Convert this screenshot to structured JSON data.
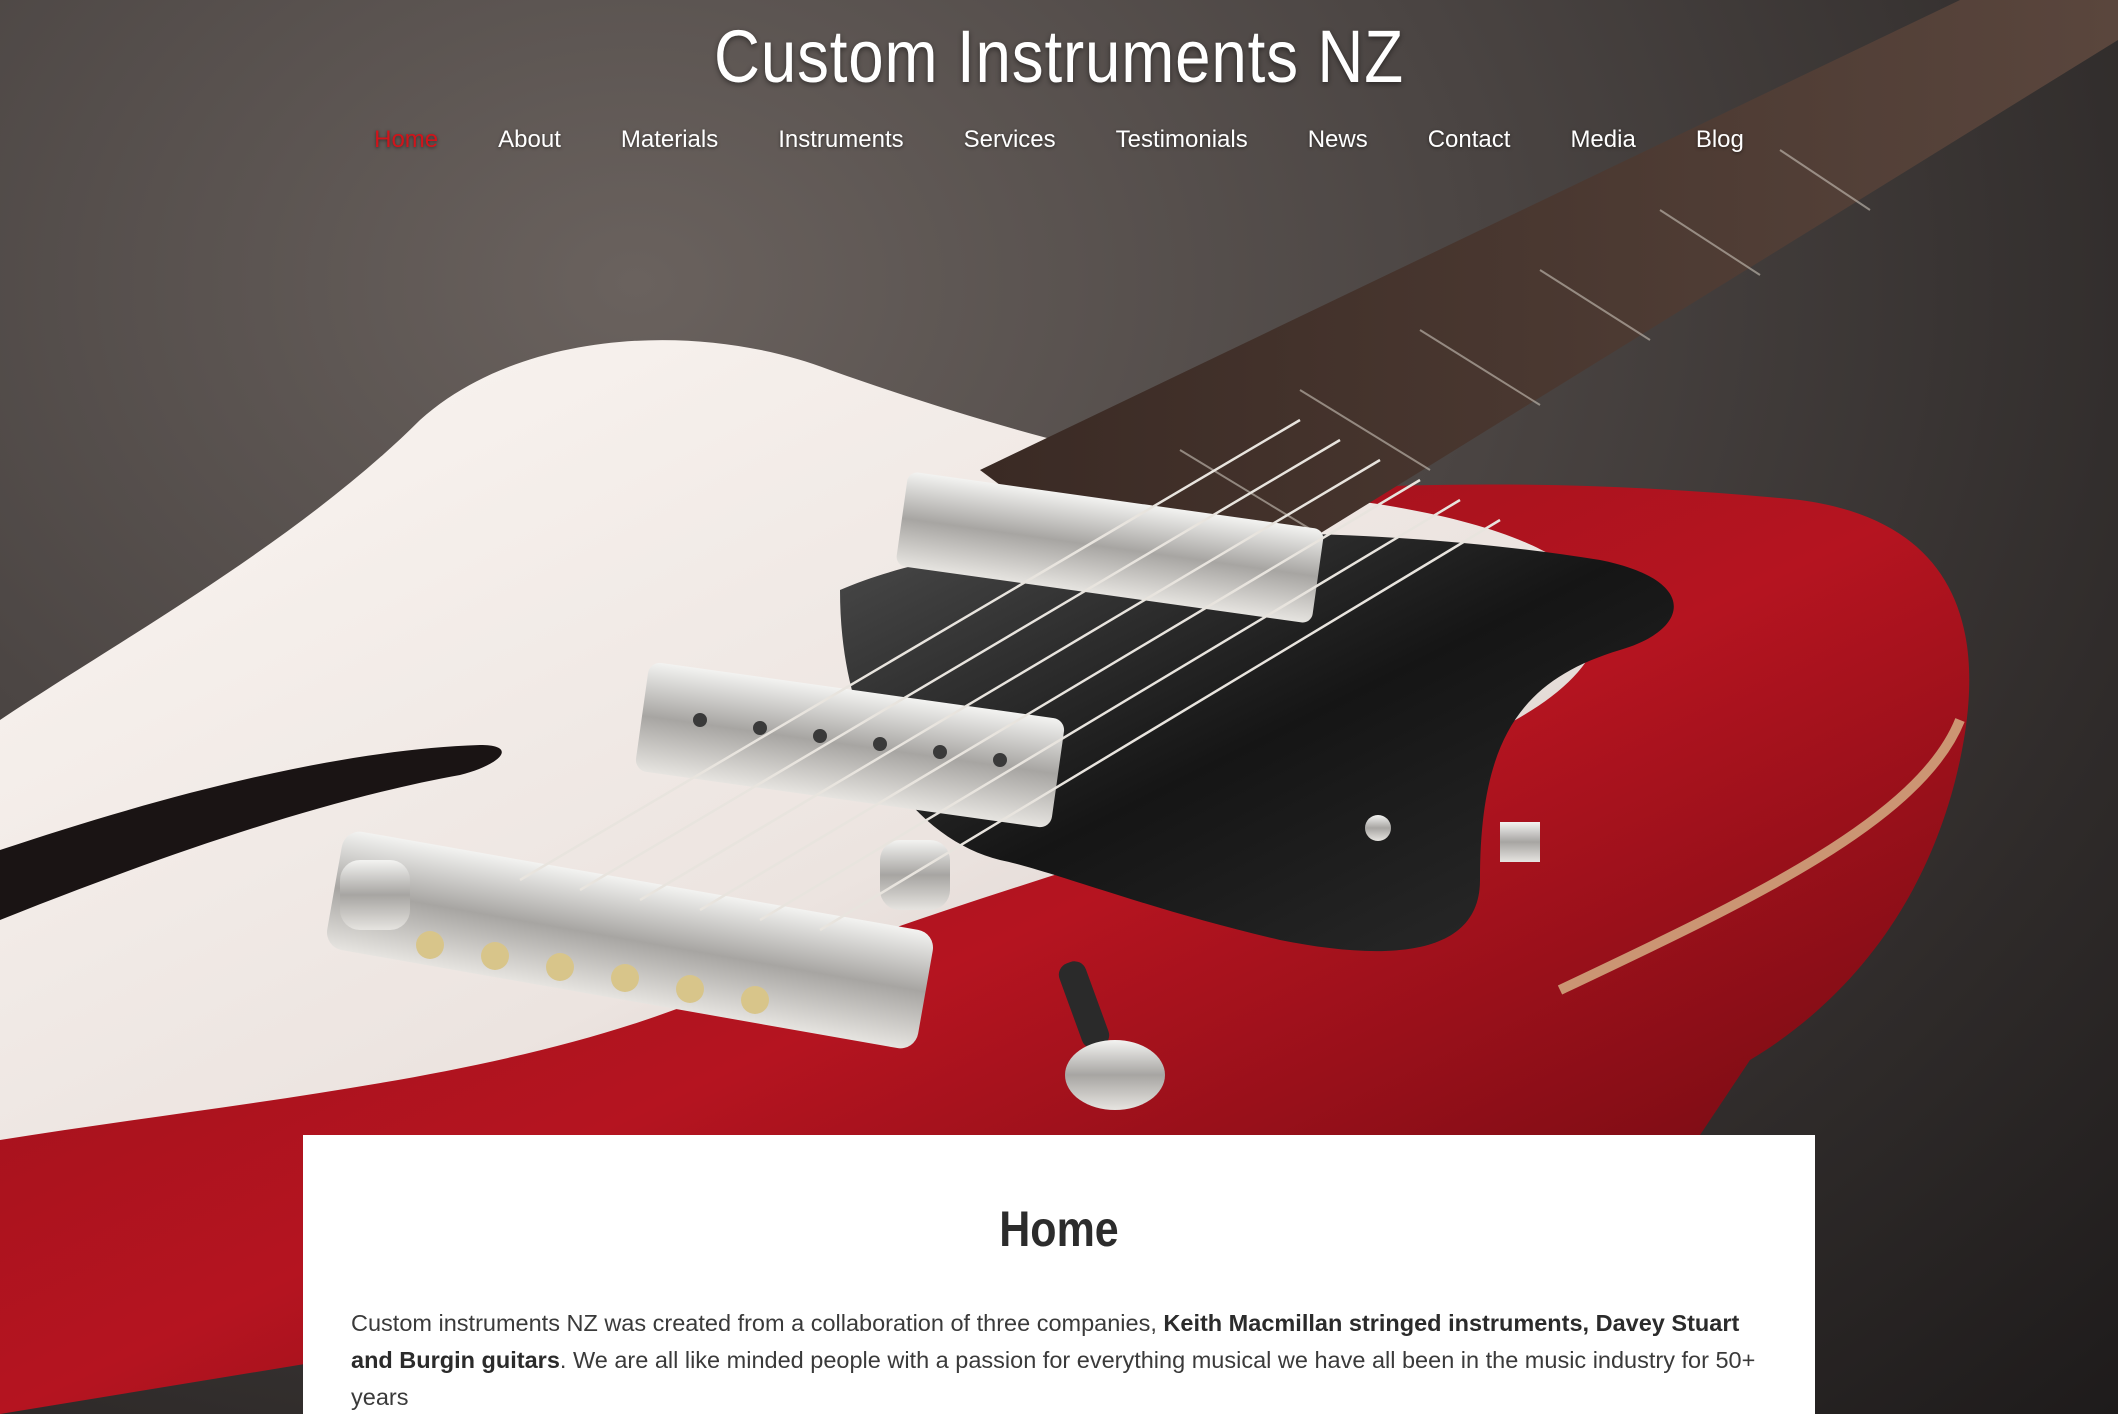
{
  "header": {
    "site_title": "Custom Instruments NZ"
  },
  "nav": {
    "items": [
      {
        "label": "Home",
        "active": true
      },
      {
        "label": "About",
        "active": false
      },
      {
        "label": "Materials",
        "active": false
      },
      {
        "label": "Instruments",
        "active": false
      },
      {
        "label": "Services",
        "active": false
      },
      {
        "label": "Testimonials",
        "active": false
      },
      {
        "label": "News",
        "active": false
      },
      {
        "label": "Contact",
        "active": false
      },
      {
        "label": "Media",
        "active": false
      },
      {
        "label": "Blog",
        "active": false
      }
    ],
    "active_color": "#d0141b"
  },
  "hero": {
    "image_subject": "red-and-white-semi-hollow-electric-guitar"
  },
  "content": {
    "heading": "Home",
    "intro_text_1": "Custom instruments NZ was created from a collaboration of three companies, ",
    "intro_bold": "Keith Macmillan stringed instruments, Davey Stuart and Burgin guitars",
    "intro_text_2": ". We are all like minded people with a passion for everything musical we have all been in the music industry for 50+ years"
  }
}
